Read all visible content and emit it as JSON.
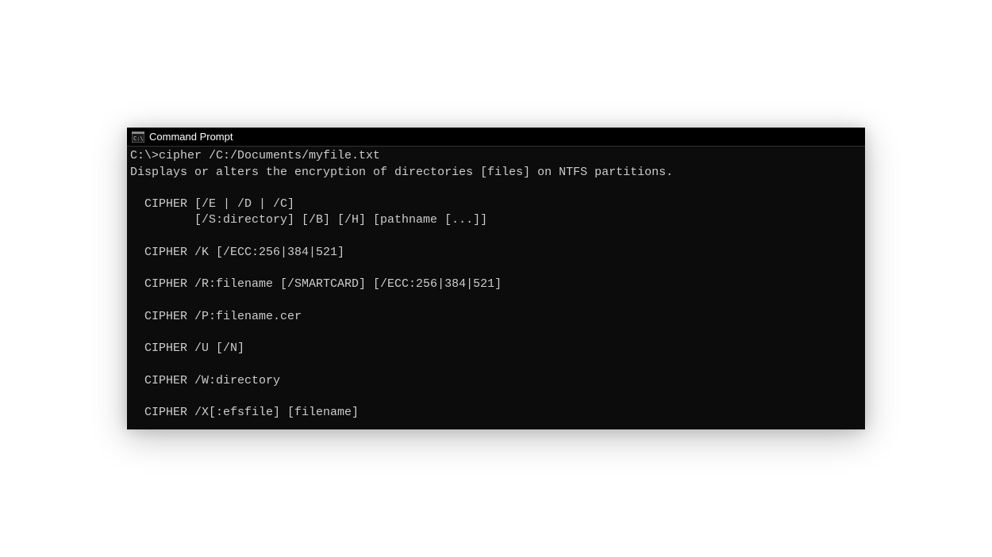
{
  "window": {
    "title": "Command Prompt"
  },
  "terminal": {
    "prompt": "C:\\>",
    "command": "cipher /C:/Documents/myfile.txt",
    "lines": [
      "Displays or alters the encryption of directories [files] on NTFS partitions.",
      "",
      "  CIPHER [/E | /D | /C]",
      "         [/S:directory] [/B] [/H] [pathname [...]]",
      "",
      "  CIPHER /K [/ECC:256|384|521]",
      "",
      "  CIPHER /R:filename [/SMARTCARD] [/ECC:256|384|521]",
      "",
      "  CIPHER /P:filename.cer",
      "",
      "  CIPHER /U [/N]",
      "",
      "  CIPHER /W:directory",
      "",
      "  CIPHER /X[:efsfile] [filename]"
    ]
  }
}
